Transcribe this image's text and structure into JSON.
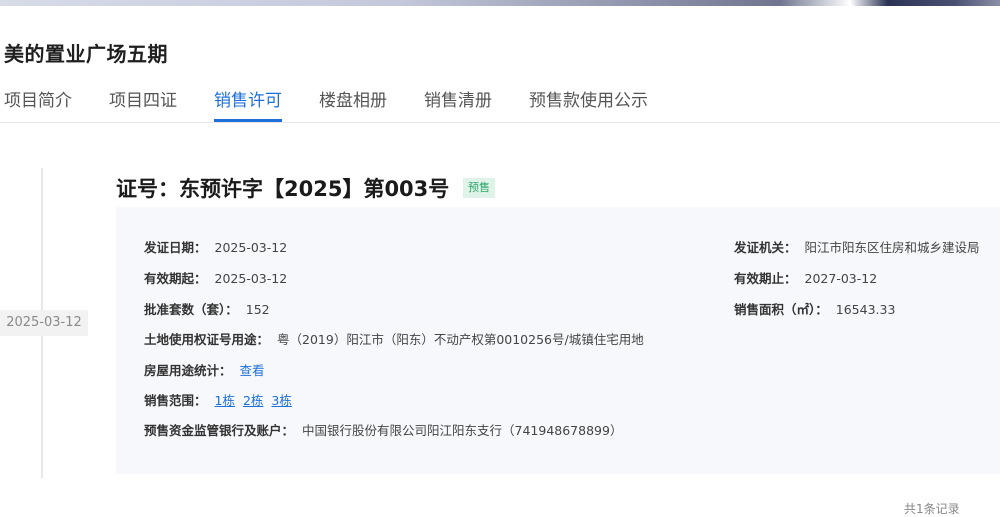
{
  "project": {
    "title": "美的置业广场五期"
  },
  "tabs": [
    {
      "label": "项目简介"
    },
    {
      "label": "项目四证"
    },
    {
      "label": "销售许可"
    },
    {
      "label": "楼盘相册"
    },
    {
      "label": "销售清册"
    },
    {
      "label": "预售款使用公示"
    }
  ],
  "active_tab": "销售许可",
  "timeline": {
    "date": "2025-03-12"
  },
  "certificate": {
    "title": "证号：东预许字【2025】第003号",
    "badge": "预售",
    "issue_date_label": "发证日期：",
    "issue_date": "2025-03-12",
    "authority_label": "发证机关：",
    "authority": "阳江市阳东区住房和城乡建设局",
    "valid_from_label": "有效期起：",
    "valid_from": "2025-03-12",
    "valid_to_label": "有效期止：",
    "valid_to": "2027-03-12",
    "approved_units_label": "批准套数（套）：",
    "approved_units": "152",
    "sale_area_label": "销售面积（㎡）：",
    "sale_area": "16543.33",
    "land_cert_label": "土地使用权证号用途：",
    "land_cert": "粤（2019）阳江市（阳东）不动产权第0010256号/城镇住宅用地",
    "usage_stats_label": "房屋用途统计：",
    "usage_stats_link": "查看",
    "sale_scope_label": "销售范围：",
    "sale_scope": [
      "1栋",
      "2栋",
      "3栋"
    ],
    "bank_label": "预售资金监管银行及账户：",
    "bank": "中国银行股份有限公司阳江阳东支行（741948678899）"
  },
  "footer": {
    "total": "共1条记录"
  }
}
